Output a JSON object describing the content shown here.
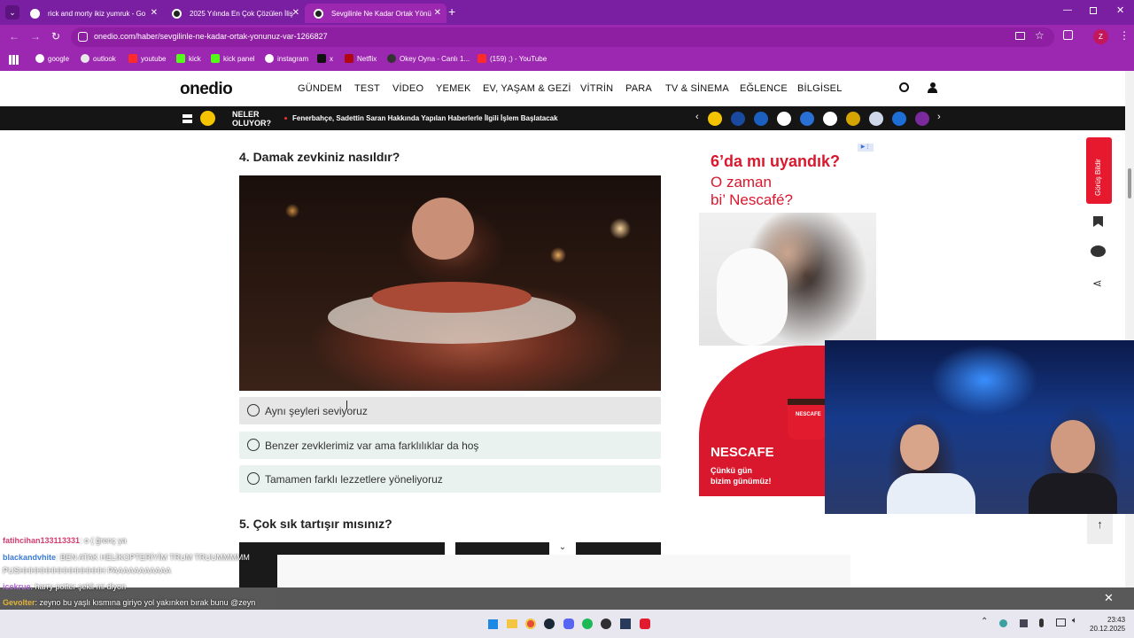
{
  "browser": {
    "tabs": [
      {
        "title": "rick and morty ikiz yumruk - Go"
      },
      {
        "title": "2025 Yılında En Çok Çözülen İliş"
      },
      {
        "title": "Sevgilinle Ne Kadar Ortak Yönü"
      }
    ],
    "url": "onedio.com/haber/sevgilinle-ne-kadar-ortak-yonunuz-var-1266827",
    "bookmarks": [
      "google",
      "outlook",
      "youtube",
      "kick",
      "kick panel",
      "instagram",
      "x",
      "Netflix",
      "Okey Oyna - Canlı 1...",
      "(159) ;) - YouTube"
    ],
    "profile_letter": "Z"
  },
  "site": {
    "logo": "onedio",
    "nav": [
      "GÜNDEM",
      "TEST",
      "VİDEO",
      "YEMEK",
      "EV, YAŞAM & GEZİ",
      "VİTRİN",
      "PARA",
      "TV & SİNEMA",
      "EĞLENCE",
      "BİLGİSEL"
    ],
    "ticker_label": "NELER\nOLUYOR?",
    "ticker_text": "Fenerbahçe, Sadettin Saran Hakkında Yapılan Haberlerle İlgili İşlem Başlatacak"
  },
  "quiz": {
    "q4": "4. Damak zevkiniz nasıldır?",
    "q4_options": [
      "Aynı şeyleri seviyoruz",
      "Benzer zevklerimiz var ama farklılıklar da hoş",
      "Tamamen farklı lezzetlere yöneliyoruz"
    ],
    "q5": "5. Çok sık tartışır mısınız?"
  },
  "ad": {
    "line1": "6’da mı uyandık?",
    "line2": "O zaman",
    "line3": "bi’ Nescafé?",
    "brand": "NESCAFE",
    "slogan1": "Çünkü gün",
    "slogan2": "bizim günümüz!",
    "mug_text": "NESCAFE"
  },
  "sidebar": {
    "feedback": "Görüş Bildir"
  },
  "chat": [
    {
      "user": "fatihcihan133113331",
      "msg": ": o ( ğrenç ya",
      "color": "#d23c6e"
    },
    {
      "user": "blackandvhite",
      "msg": ": BEN ATAK HELİKOPTERİYİM TRUM TRUUMMMMM",
      "color": "#3b7bd6"
    },
    {
      "user": "",
      "msg": "PUSHHHHHHHHHHHHHHH PAAAAAAAAAAA",
      "color": "#ffffff"
    },
    {
      "user": "icekrue",
      "msg": ": harry potter şekli mi diyon",
      "color": "#b06ad6"
    },
    {
      "user": "Gevolter",
      "msg": ": zeyno bu yaşlı kısmına giriyo yol yakınken bırak bunu @zeyn",
      "color": "#e0b43a"
    }
  ],
  "clock": {
    "time": "23:43",
    "date": "20.12.2025"
  },
  "colors": {
    "browser_purple": "#9c27b0",
    "tab_dark": "#7b1fa2",
    "feedback_red": "#e6192e",
    "nescafe_red": "#d9182d"
  }
}
